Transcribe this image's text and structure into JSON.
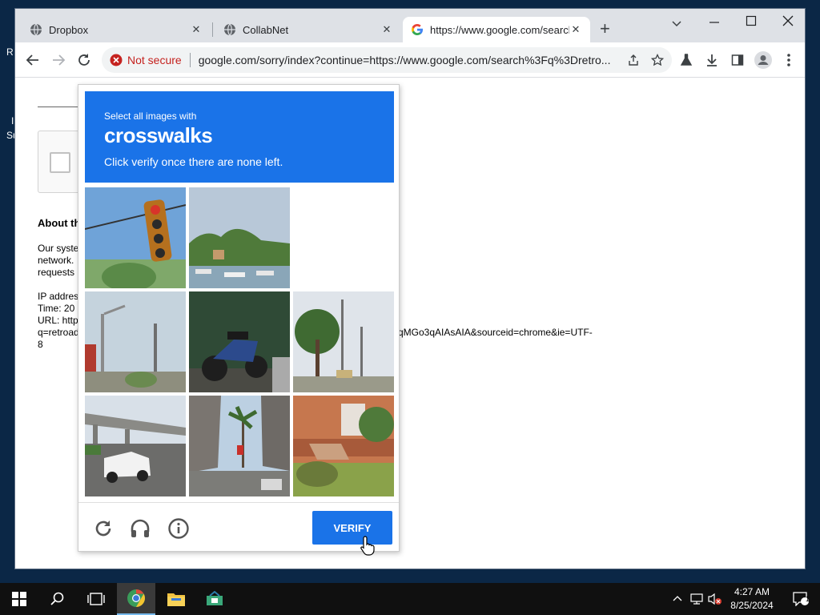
{
  "desktop": {
    "frag_r": "R",
    "frag_i": "I",
    "frag_su": "Su"
  },
  "browser": {
    "tabs": [
      {
        "title": "Dropbox",
        "icon": "globe-icon",
        "active": false
      },
      {
        "title": "CollabNet",
        "icon": "globe-icon",
        "active": false
      },
      {
        "title": "https://www.google.com/search",
        "icon": "google-icon",
        "active": true
      }
    ],
    "new_tab_label": "+",
    "address": {
      "security_text": "Not secure",
      "url": "google.com/sorry/index?continue=https://www.google.com/search%3Fq%3Dretro..."
    }
  },
  "page": {
    "about_heading": "About th",
    "lines": [
      "Our syste",
      "network.",
      "requests",
      "IP addres",
      "Time: 20",
      "URL: http",
      "q=retroad",
      "8"
    ],
    "url_tail": "qMGo3qAIAsAIA&sourceid=chrome&ie=UTF-"
  },
  "captcha": {
    "instruction_small": "Select all images with",
    "target_word": "crosswalks",
    "instruction_sub": "Click verify once there are none left.",
    "tiles": [
      "traffic-light",
      "waterfront",
      "blank",
      "street-poles",
      "motorcycle",
      "trees-street",
      "overpass-car",
      "palm-overpass",
      "brick-house"
    ],
    "verify_label": "VERIFY"
  },
  "taskbar": {
    "time": "4:27 AM",
    "date": "8/25/2024",
    "notif_count": "1"
  },
  "colors": {
    "accent": "#1a73e8",
    "not_secure": "#c5221f",
    "taskbar": "#101010"
  }
}
